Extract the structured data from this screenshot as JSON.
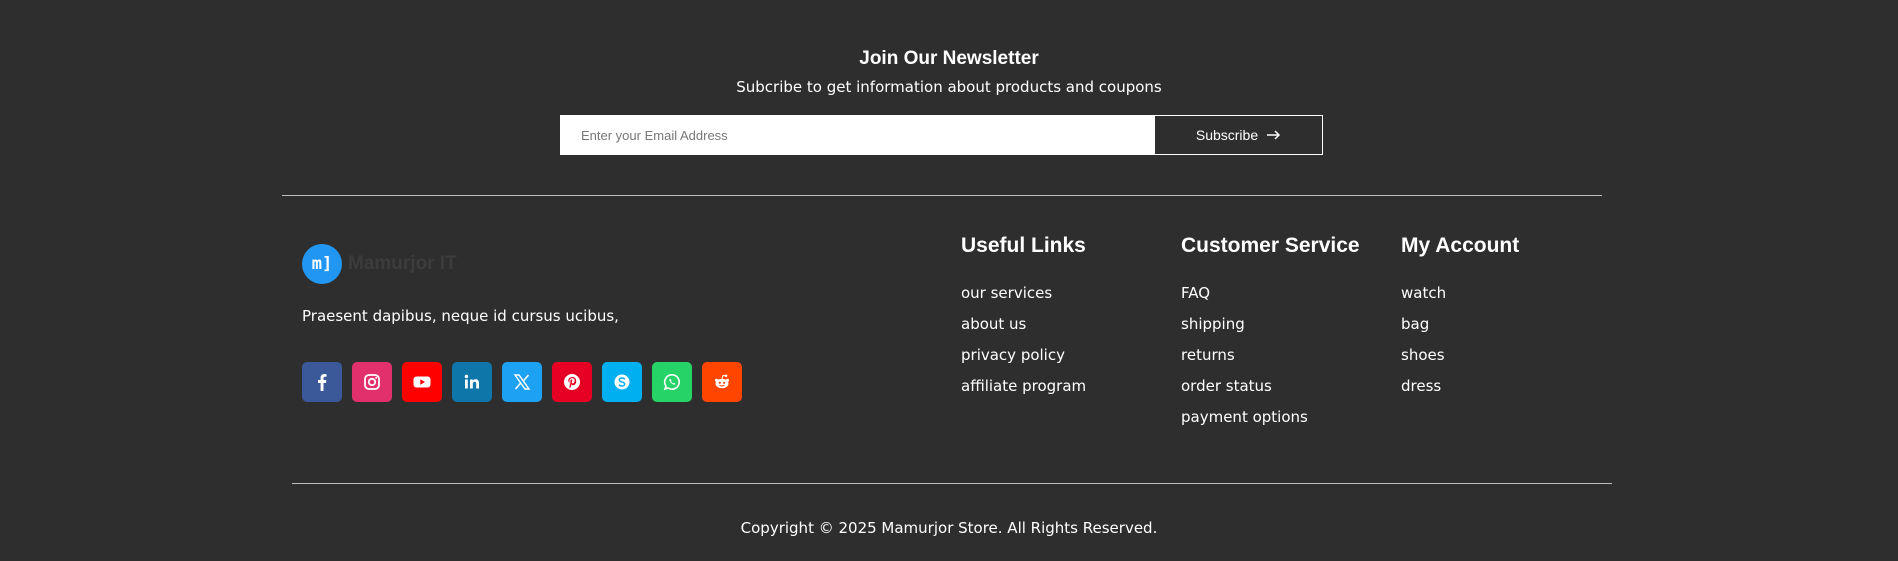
{
  "newsletter": {
    "title": "Join Our Newsletter",
    "subtitle": "Subcribe to get information about products and coupons",
    "email_placeholder": "Enter your Email Address",
    "button_label": "Subscribe",
    "button_icon": "arrow-right-icon"
  },
  "brand": {
    "logo_text": "m]",
    "name": "Mamurjor IT",
    "description": "Praesent dapibus, neque id cursus ucibus,",
    "logo_color": "#2196f3"
  },
  "socials": [
    {
      "name": "facebook",
      "icon": "facebook-icon",
      "color": "#3b5998"
    },
    {
      "name": "instagram",
      "icon": "instagram-icon",
      "color": "#e1306c"
    },
    {
      "name": "youtube",
      "icon": "youtube-icon",
      "color": "#ff0000"
    },
    {
      "name": "linkedin",
      "icon": "linkedin-icon",
      "color": "#0e76a8"
    },
    {
      "name": "x",
      "icon": "x-icon",
      "color": "#1da1f2"
    },
    {
      "name": "pinterest",
      "icon": "pinterest-icon",
      "color": "#e60023"
    },
    {
      "name": "skype",
      "icon": "skype-icon",
      "color": "#00aff0"
    },
    {
      "name": "whatsapp",
      "icon": "whatsapp-icon",
      "color": "#25d366"
    },
    {
      "name": "reddit",
      "icon": "reddit-icon",
      "color": "#ff4500"
    }
  ],
  "columns": {
    "useful_links": {
      "title": "Useful Links",
      "items": [
        "our services",
        "about us",
        "privacy policy",
        "affiliate program"
      ]
    },
    "customer_service": {
      "title": "Customer Service",
      "items": [
        "FAQ",
        "shipping",
        "returns",
        "order status",
        "payment options"
      ]
    },
    "my_account": {
      "title": "My Account",
      "items": [
        "watch",
        "bag",
        "shoes",
        "dress"
      ]
    }
  },
  "footer": {
    "copyright": "Copyright © 2025 Mamurjor Store. All Rights Reserved."
  }
}
